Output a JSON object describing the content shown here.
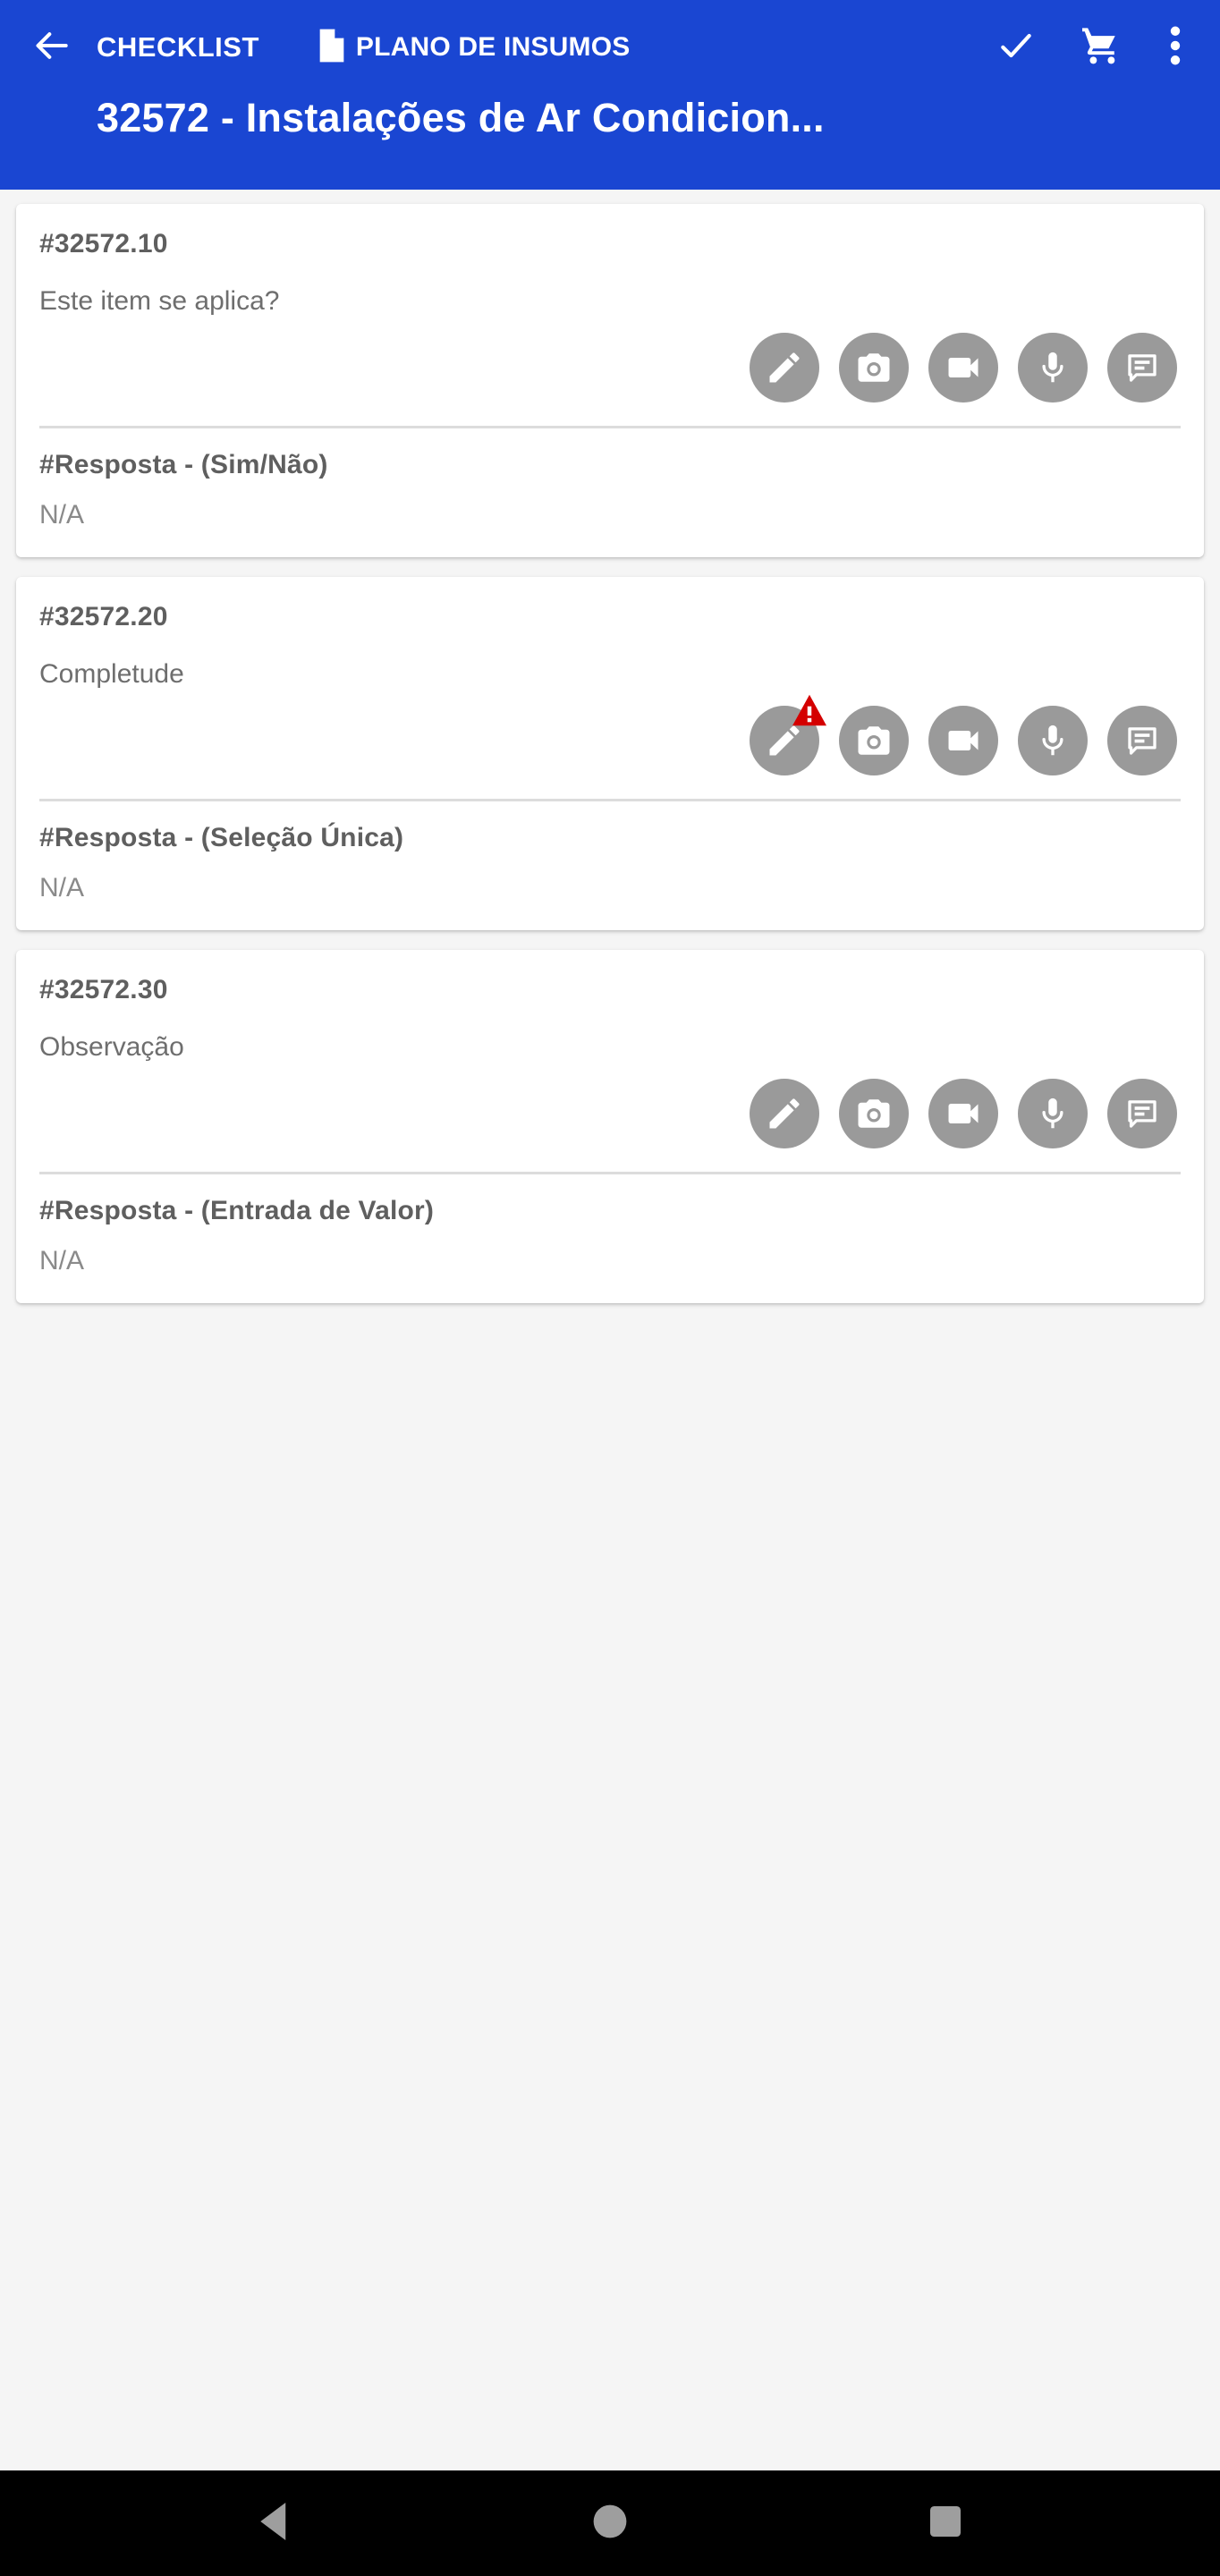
{
  "appbar": {
    "back_icon": "arrow-left-icon",
    "section_label": "CHECKLIST",
    "document_icon": "document-icon",
    "plano_label": "PLANO DE INSUMOS",
    "check_icon": "check-icon",
    "cart_icon": "shopping-cart-icon",
    "overflow_icon": "more-vertical-icon",
    "title": "32572 - Instalações de Ar Condicion...",
    "background_color": "#1a46d2",
    "foreground_color": "#ffffff"
  },
  "actions": [
    {
      "name": "edit",
      "icon": "pencil-icon"
    },
    {
      "name": "photo",
      "icon": "camera-icon"
    },
    {
      "name": "video",
      "icon": "videocam-icon"
    },
    {
      "name": "audio",
      "icon": "microphone-icon"
    },
    {
      "name": "comment",
      "icon": "comment-icon"
    }
  ],
  "colors": {
    "action_button": "#9a9a9a",
    "warning": "#d40000",
    "page_background": "#f5f5f5",
    "card_background": "#ffffff",
    "divider": "#dcdcdc"
  },
  "cards": [
    {
      "code": "#32572.10",
      "question": "Este item se aplica?",
      "answer_label": "#Resposta - (Sim/Não)",
      "answer_value": "N/A",
      "warning": false
    },
    {
      "code": "#32572.20",
      "question": "Completude",
      "answer_label": "#Resposta - (Seleção Única)",
      "answer_value": "N/A",
      "warning": true
    },
    {
      "code": "#32572.30",
      "question": "Observação",
      "answer_label": "#Resposta - (Entrada de Valor)",
      "answer_value": "N/A",
      "warning": false
    }
  ],
  "navbar": {
    "back_icon": "triangle-back-icon",
    "home_icon": "circle-home-icon",
    "recents_icon": "square-recents-icon",
    "background_color": "#000000",
    "icon_color": "#9e9e9e"
  }
}
